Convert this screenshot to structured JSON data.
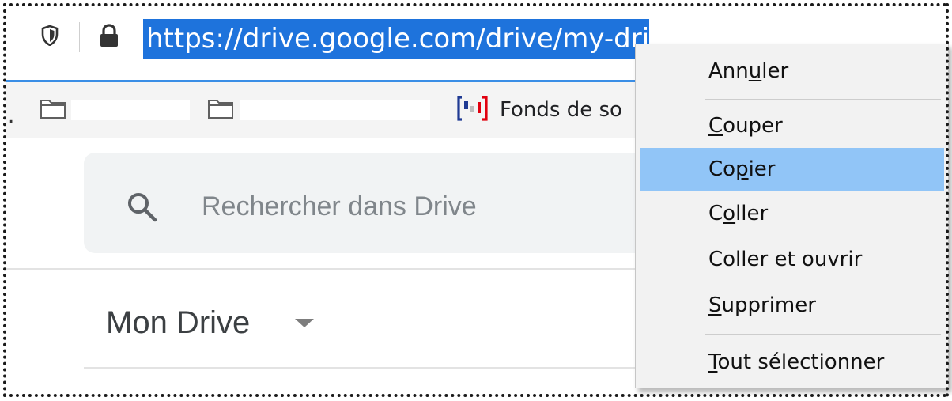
{
  "url_bar": {
    "url": "https://drive.google.com/drive/my-drive"
  },
  "bookmarks": {
    "visible_label": "Fonds de so"
  },
  "drive": {
    "search_placeholder": "Rechercher dans Drive",
    "page_title": "Mon Drive"
  },
  "context_menu": {
    "items": [
      {
        "pre": "Ann",
        "accel": "u",
        "post": "ler"
      },
      {
        "pre": "",
        "accel": "C",
        "post": "ouper"
      },
      {
        "pre": "Co",
        "accel": "p",
        "post": "ier"
      },
      {
        "pre": "C",
        "accel": "o",
        "post": "ller"
      },
      {
        "pre": "Coller et ouvrir",
        "accel": "",
        "post": ""
      },
      {
        "pre": "",
        "accel": "S",
        "post": "upprimer"
      },
      {
        "pre": "",
        "accel": "T",
        "post": "out sélectionner"
      }
    ],
    "highlighted_index": 2
  },
  "colors": {
    "selection": "#1e73dc",
    "menu_highlight": "#91c5f7",
    "urlbar_focus": "#3a8ee6"
  }
}
